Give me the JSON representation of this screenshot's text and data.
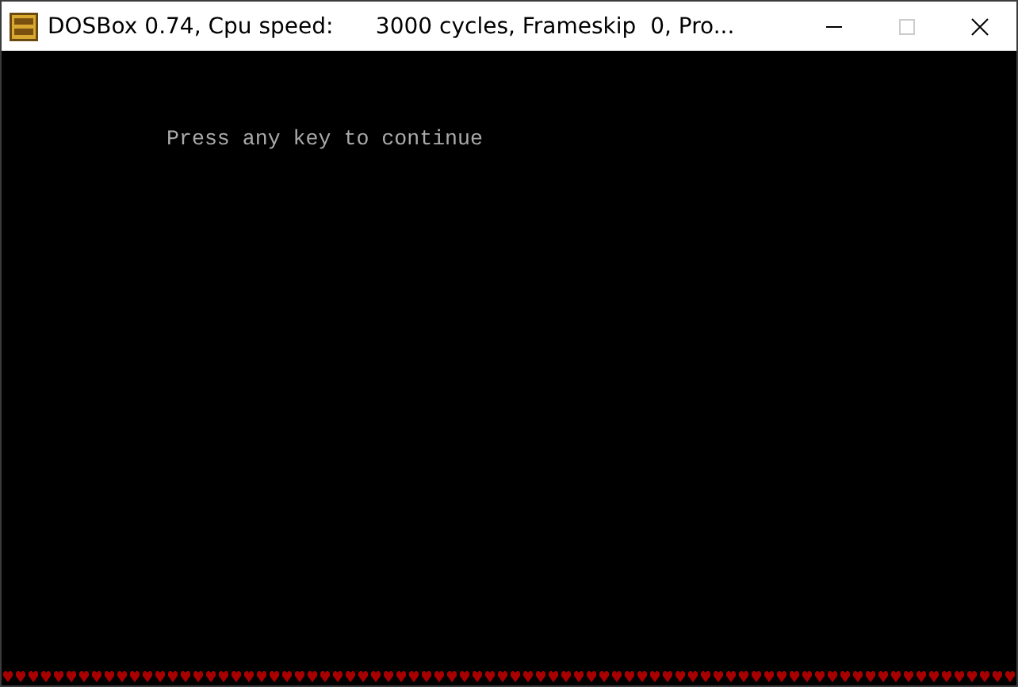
{
  "window": {
    "title": "DOSBox 0.74, Cpu speed:      3000 cycles, Frameskip  0, Pro...",
    "maximize_disabled": true
  },
  "screen": {
    "lines": [
      "Press any key to continue"
    ]
  }
}
